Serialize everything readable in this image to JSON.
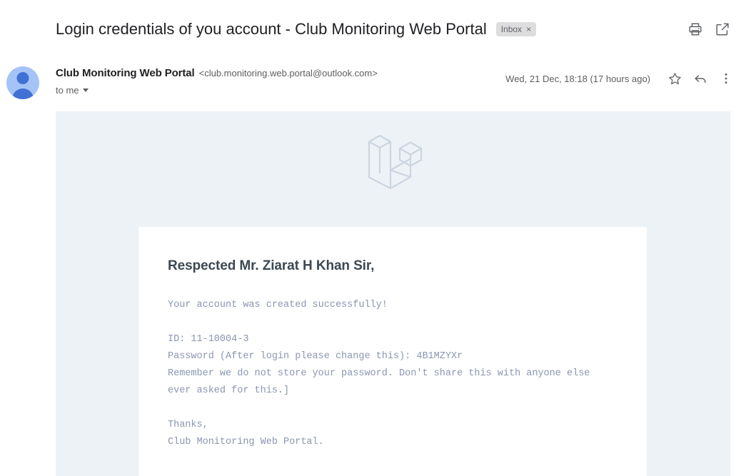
{
  "header": {
    "subject": "Login credentials of you account - Club Monitoring Web Portal",
    "label_chip": "Inbox",
    "label_chip_close": "×",
    "print_icon": "print-icon",
    "popout_icon": "open-in-new-window-icon"
  },
  "message": {
    "sender_name": "Club Monitoring Web Portal",
    "sender_email": "<club.monitoring.web.portal@outlook.com>",
    "recipient": "to me",
    "date": "Wed, 21 Dec, 18:18 (17 hours ago)",
    "star_icon": "star-icon",
    "reply_icon": "reply-icon",
    "more_icon": "more-options-icon",
    "details_caret": "chevron-down-icon"
  },
  "body": {
    "logo": "laravel-logo",
    "greeting": "Respected Mr. Ziarat H Khan Sir,",
    "paragraph_1": "Your account was created successfully!",
    "paragraph_2": "ID: 11-10004-3\nPassword (After login please change this): 4B1MZYXr\nRemember we do not store your password. Don't share this with anyone else ever asked for this.]",
    "paragraph_3": "Thanks,\nClub Monitoring Web Portal.",
    "account_id": "11-10004-3",
    "password": "4B1MZYXr"
  },
  "colors": {
    "body_background": "#edf2f7",
    "card_background": "#ffffff",
    "heading": "#3d4852",
    "mono_text": "#8a96b0",
    "logo_stroke": "#cbd5e0",
    "avatar_ring": "#a5c3f7",
    "avatar_fill": "#4071d5",
    "chip_background": "#ddddde"
  }
}
